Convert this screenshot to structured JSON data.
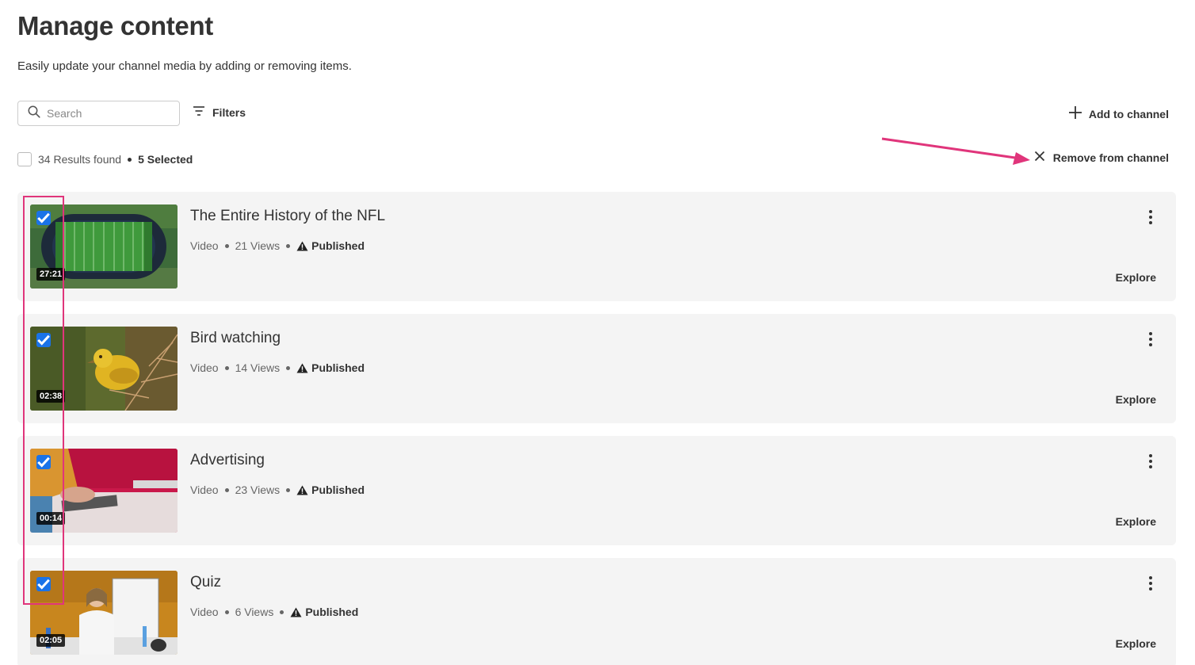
{
  "header": {
    "title": "Manage content",
    "subtitle": "Easily update your channel media by adding or removing items."
  },
  "toolbar": {
    "search_placeholder": "Search",
    "filters_label": "Filters",
    "add_label": "Add to channel",
    "remove_label": "Remove from channel"
  },
  "results": {
    "count_text": "34 Results found",
    "selected_text": "5 Selected"
  },
  "colors": {
    "accent": "#1a73e8",
    "annotation": "#e0357b",
    "card_bg": "#f4f4f4"
  },
  "items": [
    {
      "title": "The Entire History of the NFL",
      "type": "Video",
      "views": "21 Views",
      "status": "Published",
      "duration": "27:21",
      "explore": "Explore",
      "checked": true
    },
    {
      "title": "Bird watching",
      "type": "Video",
      "views": "14 Views",
      "status": "Published",
      "duration": "02:38",
      "explore": "Explore",
      "checked": true
    },
    {
      "title": "Advertising",
      "type": "Video",
      "views": "23 Views",
      "status": "Published",
      "duration": "00:14",
      "explore": "Explore",
      "checked": true
    },
    {
      "title": "Quiz",
      "type": "Video",
      "views": "6 Views",
      "status": "Published",
      "duration": "02:05",
      "explore": "Explore",
      "checked": true
    }
  ]
}
